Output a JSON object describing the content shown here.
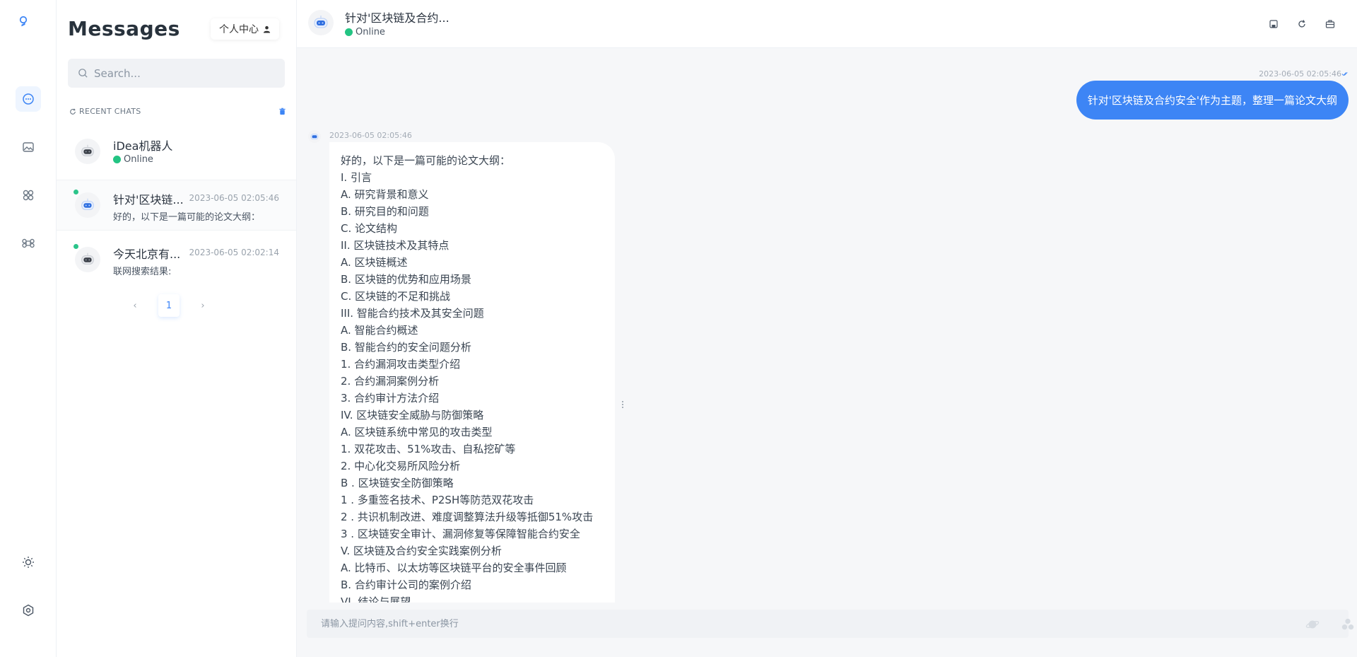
{
  "sidebar": {
    "title": "Messages",
    "personal_center_label": "个人中心",
    "search_placeholder": "Search...",
    "recent_chats_label": "RECENT CHATS",
    "chats": [
      {
        "name": "iDea机器人",
        "status": "Online",
        "time": "",
        "preview": ""
      },
      {
        "name": "针对'区块链...",
        "status": "",
        "time": "2023-06-05 02:05:46",
        "preview": "好的，以下是一篇可能的论文大纲："
      },
      {
        "name": "今天北京有...",
        "status": "",
        "time": "2023-06-05 02:02:14",
        "preview": "联网搜索结果:"
      }
    ],
    "pagination": {
      "prev": "‹",
      "current": "1",
      "next": "›"
    }
  },
  "header": {
    "title": "针对'区块链及合约...",
    "status": "Online"
  },
  "conversation": {
    "user_message": {
      "time": "2023-06-05 02:05:46",
      "text": "针对'区块链及合约安全'作为主题，整理一篇论文大纲"
    },
    "bot_message": {
      "time": "2023-06-05 02:05:46",
      "lines": [
        "好的，以下是一篇可能的论文大纲：",
        "I. 引言",
        "A. 研究背景和意义",
        "B. 研究目的和问题",
        "C. 论文结构",
        "II. 区块链技术及其特点",
        "A. 区块链概述",
        "B. 区块链的优势和应用场景",
        "C. 区块链的不足和挑战",
        "III. 智能合约技术及其安全问题",
        "A. 智能合约概述",
        "B. 智能合约的安全问题分析",
        "1. 合约漏洞攻击类型介绍",
        "2. 合约漏洞案例分析",
        "3. 合约审计方法介绍",
        "IV. 区块链安全威胁与防御策略",
        "A. 区块链系统中常见的攻击类型",
        "1. 双花攻击、51%攻击、自私挖矿等",
        "2. 中心化交易所风险分析",
        "B . 区块链安全防御策略",
        "1 . 多重签名技术、P2SH等防范双花攻击",
        "2 . 共识机制改进、难度调整算法升级等抵御51%攻击",
        "3 . 区块链安全审计、漏洞修复等保障智能合约安全",
        "V. 区块链及合约安全实践案例分析",
        "A. 比特币、以太坊等区块链平台的安全事件回顾",
        "B. 合约审计公司的案例介绍",
        "VI. 结论与展望"
      ]
    }
  },
  "input": {
    "placeholder": "请输入提问内容,shift+enter换行"
  },
  "colors": {
    "accent": "#3d85f5",
    "online": "#23c483"
  }
}
